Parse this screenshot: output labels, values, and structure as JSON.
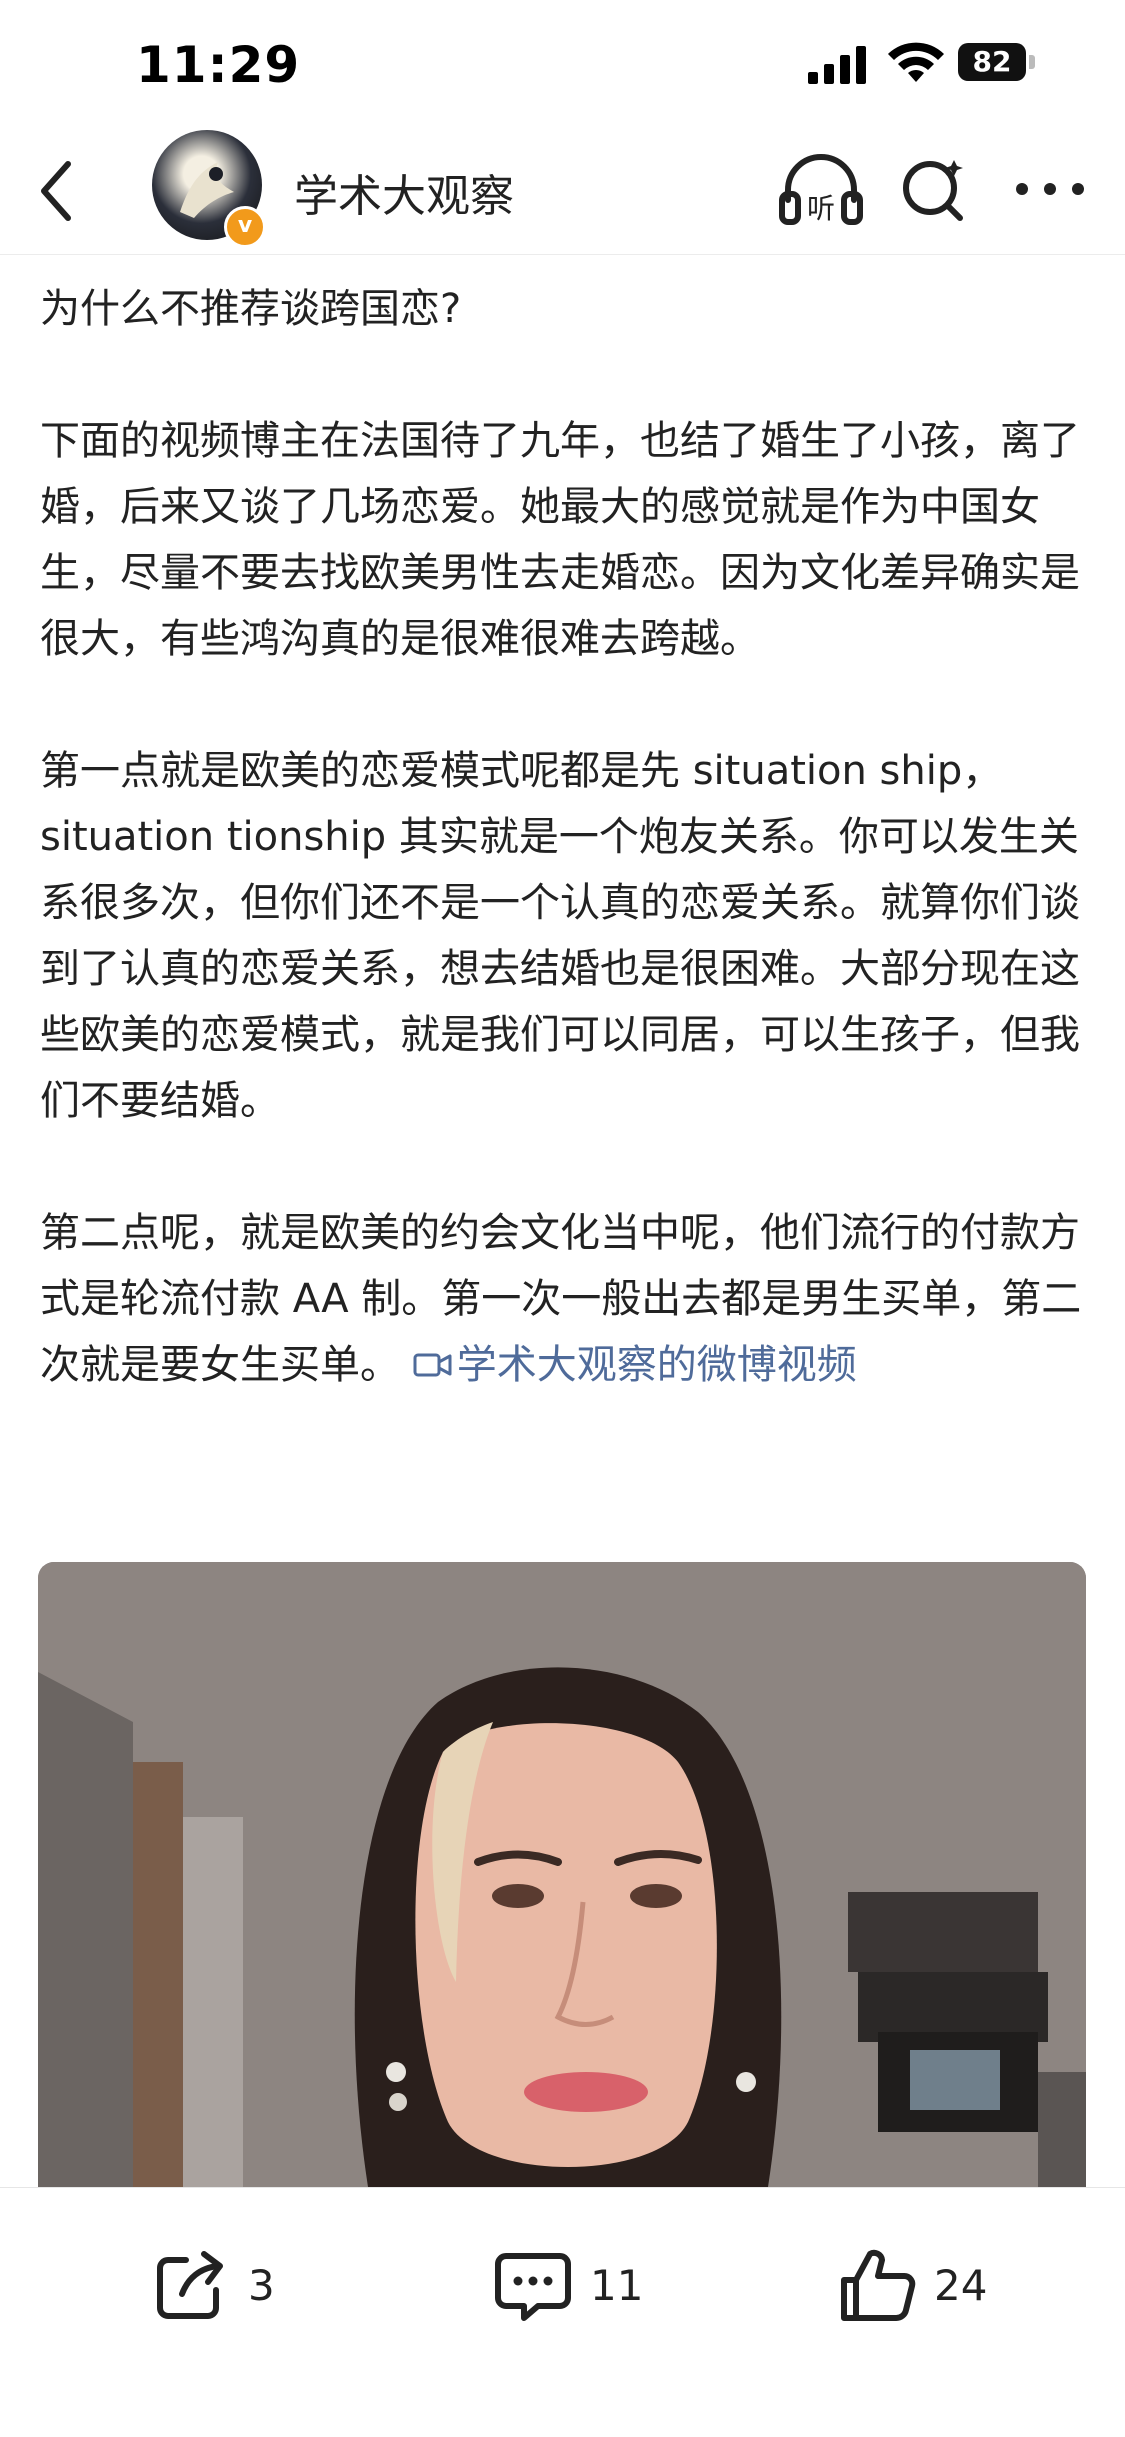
{
  "status_bar": {
    "time": "11:29",
    "battery": "82"
  },
  "header": {
    "account_name": "学术大观察",
    "verified_badge": "v"
  },
  "post": {
    "paragraphs": [
      "为什么不推荐谈跨国恋?",
      "下面的视频博主在法国待了九年，也结了婚生了小孩，离了婚，后来又谈了几场恋爱。她最大的感觉就是作为中国女生，尽量不要去找欧美男性去走婚恋。因为文化差异确实是很大，有些鸿沟真的是很难很难去跨越。",
      "第一点就是欧美的恋爱模式呢都是先 situation ship，situation tionship 其实就是一个炮友关系。你可以发生关系很多次，但你们还不是一个认真的恋爱关系。就算你们谈到了认真的恋爱关系，想去结婚也是很困难。大部分现在这些欧美的恋爱模式，就是我们可以同居，可以生孩子，但我们不要结婚。",
      "第二点呢，就是欧美的约会文化当中呢，他们流行的付款方式是轮流付款 AA 制。第一次一般出去都是男生买单，第二次就是要女生买单。"
    ],
    "video_link": "学术大观察的微博视频"
  },
  "actions": {
    "share_count": "3",
    "comment_count": "11",
    "like_count": "24"
  }
}
